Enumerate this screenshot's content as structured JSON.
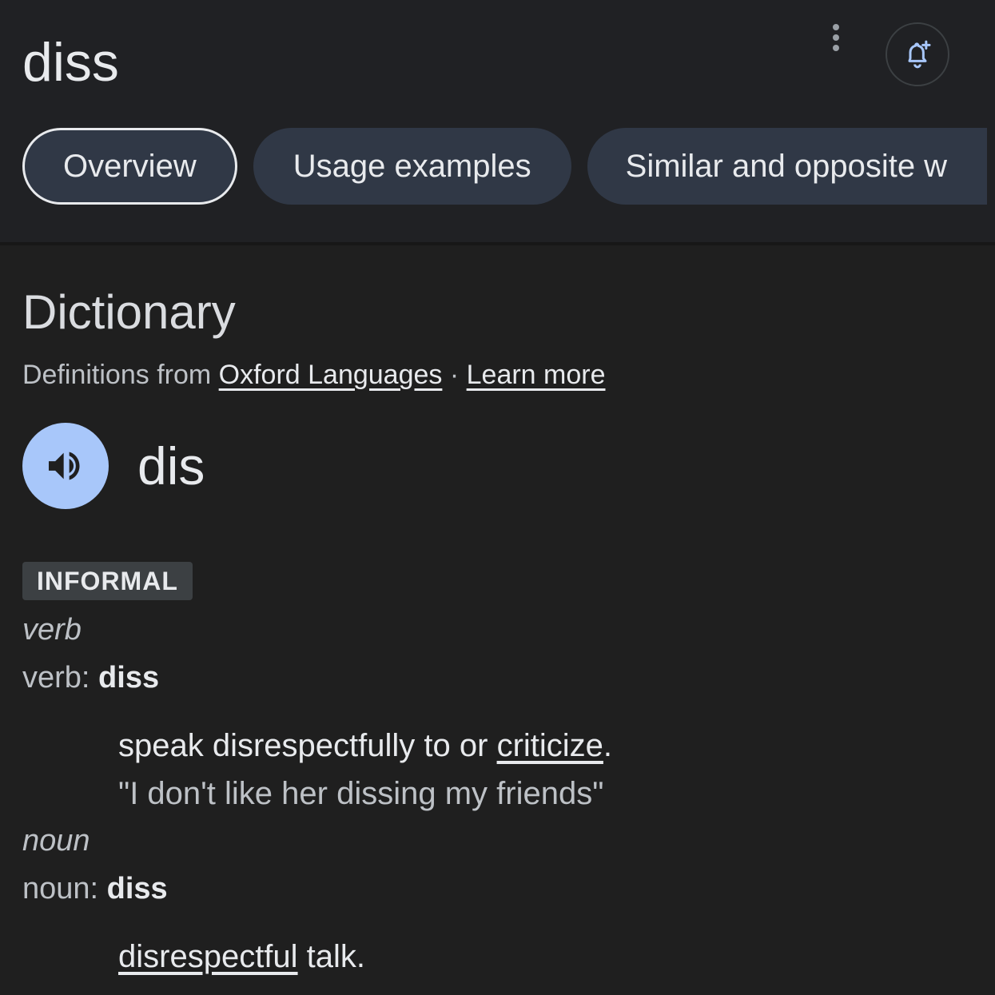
{
  "header": {
    "query": "diss",
    "more_icon": "more-vert-icon",
    "alert_icon": "bell-add-icon",
    "alert_color": "#a8c7fa"
  },
  "tabs": [
    {
      "label": "Overview",
      "selected": true
    },
    {
      "label": "Usage examples",
      "selected": false
    },
    {
      "label": "Similar and opposite w",
      "selected": false
    }
  ],
  "dictionary": {
    "title": "Dictionary",
    "source_prefix": "Definitions from ",
    "source_link": "Oxford Languages",
    "separator": " · ",
    "learn_more": "Learn more",
    "audio_icon": "speaker-icon",
    "audio_color": "#a8c7fa",
    "phonetic": "dis",
    "label": "INFORMAL",
    "entries": [
      {
        "pos": "verb",
        "pos_prefix": "verb: ",
        "headword": "diss",
        "def_text": "speak disrespectfully to or ",
        "def_link": "criticize",
        "def_suffix": ".",
        "example": "\"I don't like her dissing my friends\""
      },
      {
        "pos": "noun",
        "pos_prefix": "noun: ",
        "headword": "diss",
        "def_link": "disrespectful",
        "def_text": " talk."
      }
    ]
  }
}
